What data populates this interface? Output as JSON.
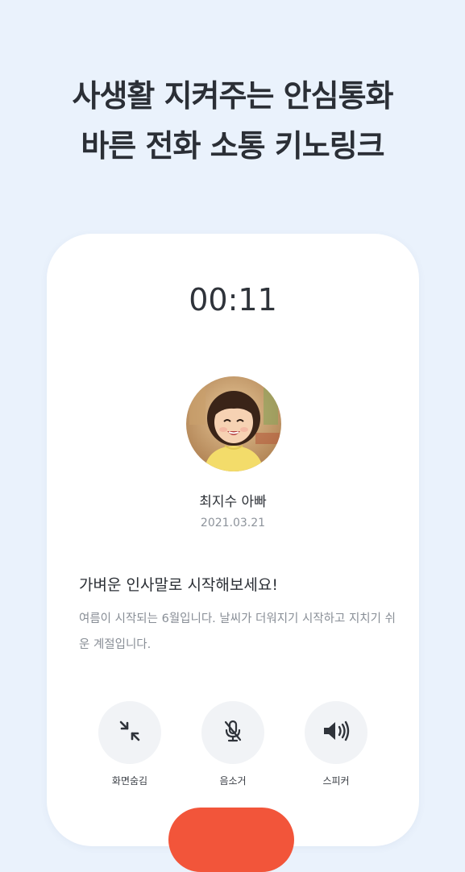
{
  "headline": {
    "line1": "사생활 지켜주는 안심통화",
    "line2": "바른 전화 소통 키노링크"
  },
  "call": {
    "timer": "00:11",
    "caller_name": "최지수 아빠",
    "caller_date": "2021.03.21"
  },
  "tip": {
    "title": "가벼운 인사말로 시작해보세요!",
    "body": "여름이 시작되는 6월입니다. 날씨가 더워지기 시작하고 지치기 쉬운 계절입니다."
  },
  "controls": {
    "hide_label": "화면숨김",
    "mute_label": "음소거",
    "speaker_label": "스피커"
  },
  "colors": {
    "background": "#eaf2fc",
    "card": "#ffffff",
    "end_call": "#f2553a",
    "button_bg": "#f1f3f6"
  },
  "icons": {
    "hide": "minimize-arrows-icon",
    "mute": "microphone-off-icon",
    "speaker": "speaker-volume-icon"
  }
}
